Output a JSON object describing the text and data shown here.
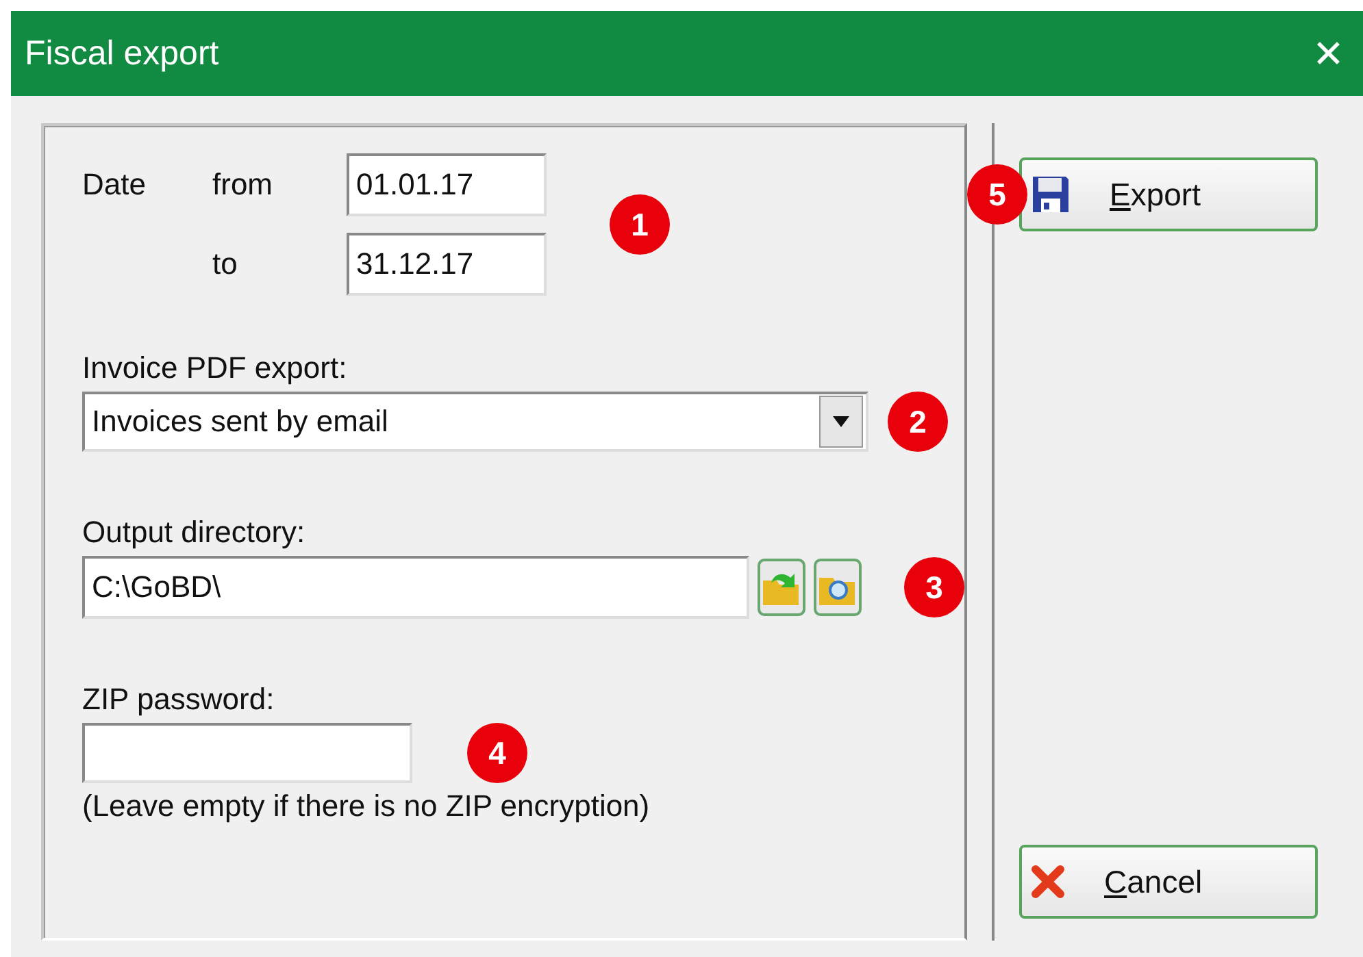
{
  "window": {
    "title": "Fiscal export",
    "close": "✕"
  },
  "date": {
    "label": "Date",
    "from_label": "from",
    "from_value": "01.01.17",
    "to_label": "to",
    "to_value": "31.12.17",
    "badge": "1"
  },
  "invoice_pdf": {
    "label": "Invoice PDF export:",
    "value": "Invoices sent by email",
    "badge": "2"
  },
  "output": {
    "label": "Output directory:",
    "value": "C:\\GoBD\\",
    "badge": "3"
  },
  "zip": {
    "label": "ZIP password:",
    "note": "(Leave empty if there is no ZIP encryption)",
    "badge": "4"
  },
  "buttons": [
    {
      "kind": "export",
      "label": "Export",
      "badge": "5"
    },
    {
      "kind": "cancel",
      "label": "Cancel"
    }
  ]
}
